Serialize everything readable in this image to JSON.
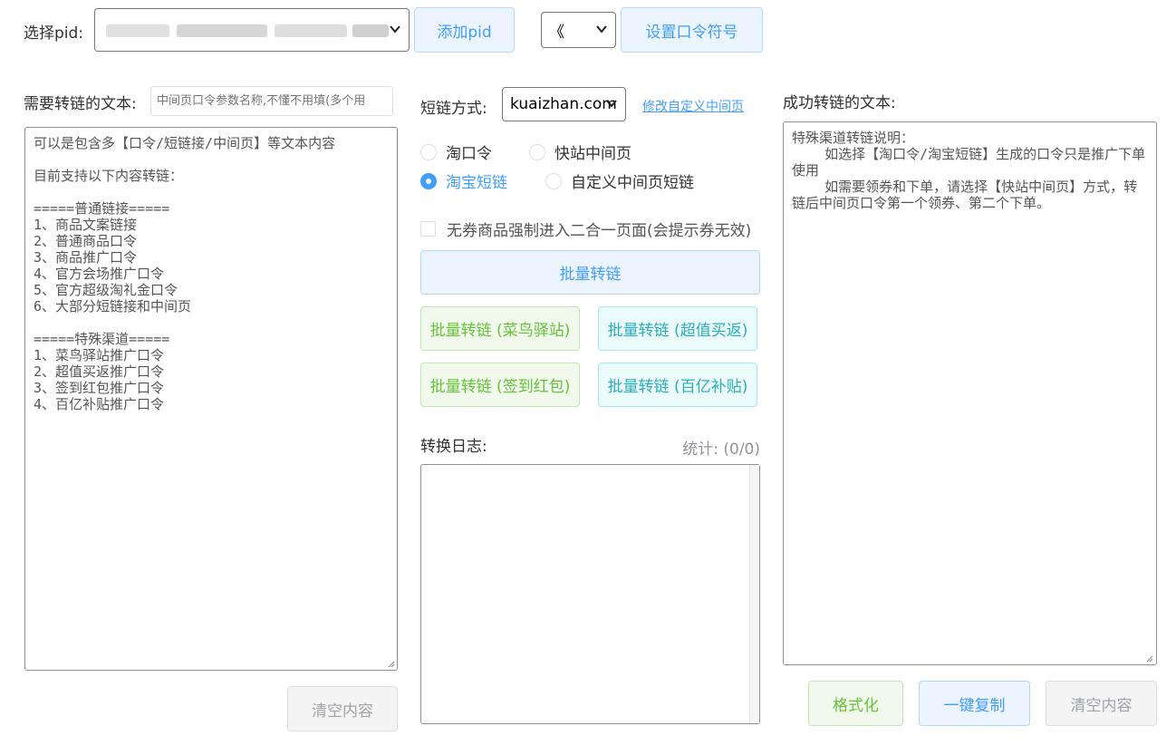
{
  "top": {
    "pid_label": "选择pid:",
    "pid_selected": "",
    "add_pid_button": "添加pid",
    "symbol_selected": "《",
    "set_symbol_button": "设置口令符号"
  },
  "left": {
    "label": "需要转链的文本:",
    "param_placeholder": "中间页口令参数名称,不懂不用填(多个用",
    "input_text": "可以是包含多【口令/短链接/中间页】等文本内容\n\n目前支持以下内容转链：\n\n=====普通链接=====\n1、商品文案链接\n2、普通商品口令\n3、商品推广口令\n4、官方会场推广口令\n5、官方超级淘礼金口令\n6、大部分短链接和中间页\n\n=====特殊渠道=====\n1、菜鸟驿站推广口令\n2、超值买返推广口令\n3、签到红包推广口令\n4、百亿补贴推广口令",
    "clear_button": "清空内容"
  },
  "middle": {
    "short_label": "短链方式:",
    "short_selected": "kuaizhan.com",
    "modify_link": "修改自定义中间页",
    "radios": [
      {
        "label": "淘口令",
        "checked": false
      },
      {
        "label": "快站中间页",
        "checked": false
      },
      {
        "label": "淘宝短链",
        "checked": true
      },
      {
        "label": "自定义中间页短链",
        "checked": false
      }
    ],
    "checkbox_label": "无券商品强制进入二合一页面(会提示券无效)",
    "batch_button": "批量转链",
    "btn_cainiao": "批量转链 (菜鸟驿站)",
    "btn_chaozhi": "批量转链 (超值买返)",
    "btn_qiandao": "批量转链 (签到红包)",
    "btn_baiyi": "批量转链 (百亿补贴)",
    "log_label": "转换日志:",
    "stats": "统计: (0/0)"
  },
  "right": {
    "label": "成功转链的文本:",
    "output_text": "特殊渠道转链说明：\n    如选择【淘口令/淘宝短链】生成的口令只是推广下单使用\n    如需要领券和下单，请选择【快站中间页】方式，转链后中间页口令第一个领券、第二个下单。",
    "format_button": "格式化",
    "copy_button": "一键复制",
    "clear_button": "清空内容"
  },
  "colors": {
    "primary": "#409eff",
    "success": "#67c23a",
    "cyan": "#2aaeb9",
    "gray": "#a0a3a8"
  }
}
